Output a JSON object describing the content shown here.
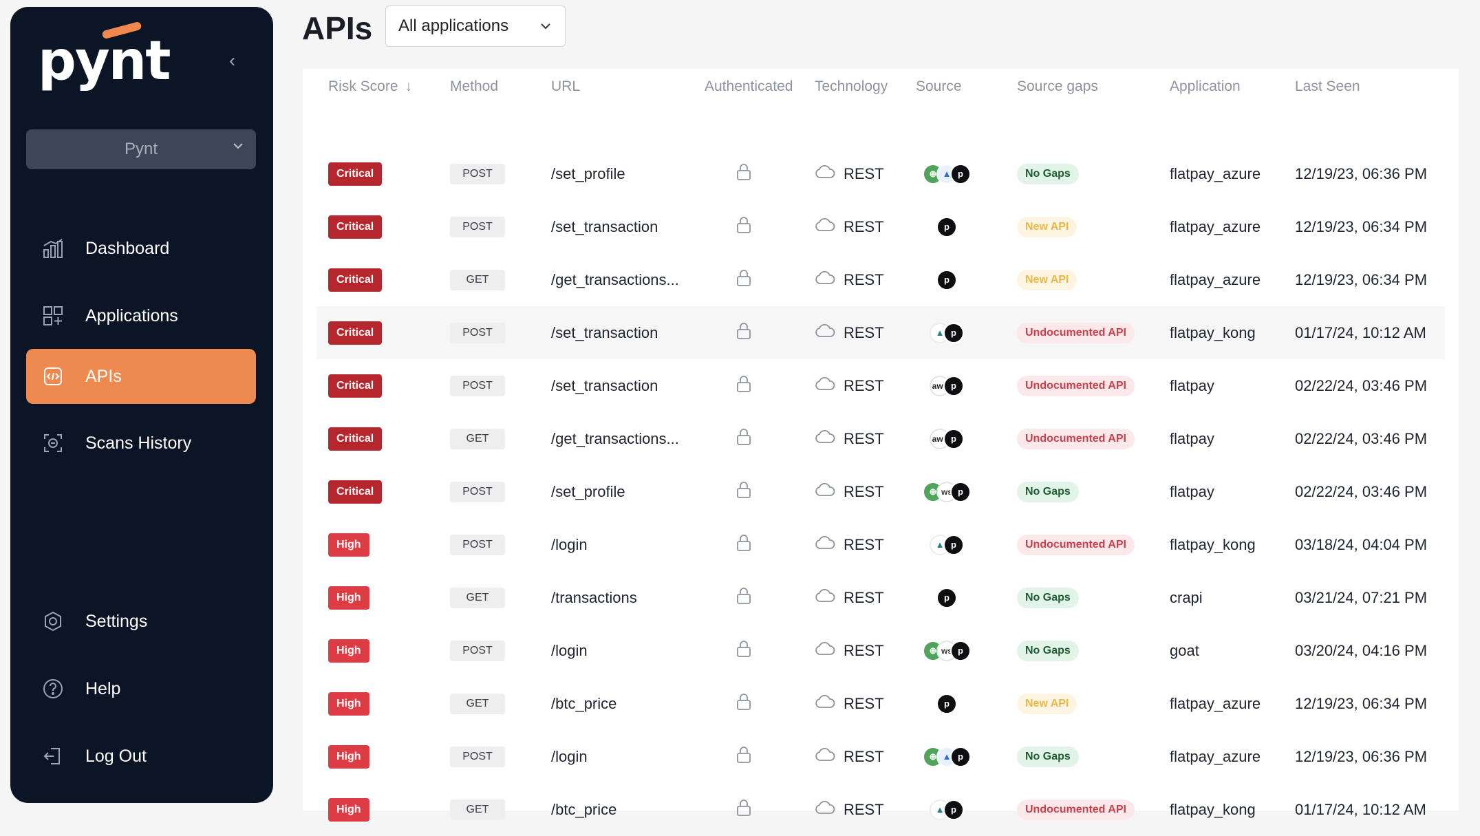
{
  "sidebar": {
    "logo": "pynt",
    "org_select": "Pynt",
    "nav": [
      {
        "label": "Dashboard",
        "icon": "chart-icon"
      },
      {
        "label": "Applications",
        "icon": "grid-plus-icon"
      },
      {
        "label": "APIs",
        "icon": "code-icon"
      },
      {
        "label": "Scans History",
        "icon": "scan-icon"
      }
    ],
    "bottom": [
      {
        "label": "Settings",
        "icon": "gear-icon"
      },
      {
        "label": "Help",
        "icon": "help-icon"
      },
      {
        "label": "Log Out",
        "icon": "logout-icon"
      }
    ]
  },
  "header": {
    "title": "APIs",
    "app_filter": "All applications"
  },
  "table": {
    "columns": [
      "Risk Score",
      "Method",
      "URL",
      "Authenticated",
      "Technology",
      "Source",
      "Source gaps",
      "Application",
      "Last Seen"
    ],
    "sort_arrow": "↓",
    "rows": [
      {
        "risk": "Critical",
        "method": "POST",
        "url": "/set_profile",
        "tech": "REST",
        "sources": [
          "azure",
          "tri",
          "pynt"
        ],
        "gap": "No Gaps",
        "app": "flatpay_azure",
        "seen": "12/19/23, 06:36 PM"
      },
      {
        "risk": "Critical",
        "method": "POST",
        "url": "/set_transaction",
        "tech": "REST",
        "sources": [
          "pynt"
        ],
        "gap": "New API",
        "app": "flatpay_azure",
        "seen": "12/19/23, 06:34 PM"
      },
      {
        "risk": "Critical",
        "method": "GET",
        "url": "/get_transactions...",
        "tech": "REST",
        "sources": [
          "pynt"
        ],
        "gap": "New API",
        "app": "flatpay_azure",
        "seen": "12/19/23, 06:34 PM"
      },
      {
        "risk": "Critical",
        "method": "POST",
        "url": "/set_transaction",
        "tech": "REST",
        "sources": [
          "kong",
          "pynt"
        ],
        "gap": "Undocumented API",
        "app": "flatpay_kong",
        "seen": "01/17/24, 10:12 AM"
      },
      {
        "risk": "Critical",
        "method": "POST",
        "url": "/set_transaction",
        "tech": "REST",
        "sources": [
          "aws",
          "pynt"
        ],
        "gap": "Undocumented API",
        "app": "flatpay",
        "seen": "02/22/24, 03:46 PM"
      },
      {
        "risk": "Critical",
        "method": "GET",
        "url": "/get_transactions...",
        "tech": "REST",
        "sources": [
          "aws",
          "pynt"
        ],
        "gap": "Undocumented API",
        "app": "flatpay",
        "seen": "02/22/24, 03:46 PM"
      },
      {
        "risk": "Critical",
        "method": "POST",
        "url": "/set_profile",
        "tech": "REST",
        "sources": [
          "azure",
          "ws",
          "pynt"
        ],
        "gap": "No Gaps",
        "app": "flatpay",
        "seen": "02/22/24, 03:46 PM"
      },
      {
        "risk": "High",
        "method": "POST",
        "url": "/login",
        "tech": "REST",
        "sources": [
          "kong",
          "pynt"
        ],
        "gap": "Undocumented API",
        "app": "flatpay_kong",
        "seen": "03/18/24, 04:04 PM"
      },
      {
        "risk": "High",
        "method": "GET",
        "url": "/transactions",
        "tech": "REST",
        "sources": [
          "pynt"
        ],
        "gap": "No Gaps",
        "app": "crapi",
        "seen": "03/21/24, 07:21 PM"
      },
      {
        "risk": "High",
        "method": "POST",
        "url": "/login",
        "tech": "REST",
        "sources": [
          "azure",
          "ws",
          "pynt"
        ],
        "gap": "No Gaps",
        "app": "goat",
        "seen": "03/20/24, 04:16 PM"
      },
      {
        "risk": "High",
        "method": "GET",
        "url": "/btc_price",
        "tech": "REST",
        "sources": [
          "pynt"
        ],
        "gap": "New API",
        "app": "flatpay_azure",
        "seen": "12/19/23, 06:34 PM"
      },
      {
        "risk": "High",
        "method": "POST",
        "url": "/login",
        "tech": "REST",
        "sources": [
          "azure",
          "tri",
          "pynt"
        ],
        "gap": "No Gaps",
        "app": "flatpay_azure",
        "seen": "12/19/23, 06:36 PM"
      },
      {
        "risk": "High",
        "method": "GET",
        "url": "/btc_price",
        "tech": "REST",
        "sources": [
          "kong",
          "pynt"
        ],
        "gap": "Undocumented API",
        "app": "flatpay_kong",
        "seen": "01/17/24, 10:12 AM"
      }
    ],
    "highlighted_row": 3
  },
  "colors": {
    "sidebar_bg": "#0c1526",
    "accent": "#ee8a50",
    "critical": "#b5272d",
    "high": "#dd3c45"
  }
}
